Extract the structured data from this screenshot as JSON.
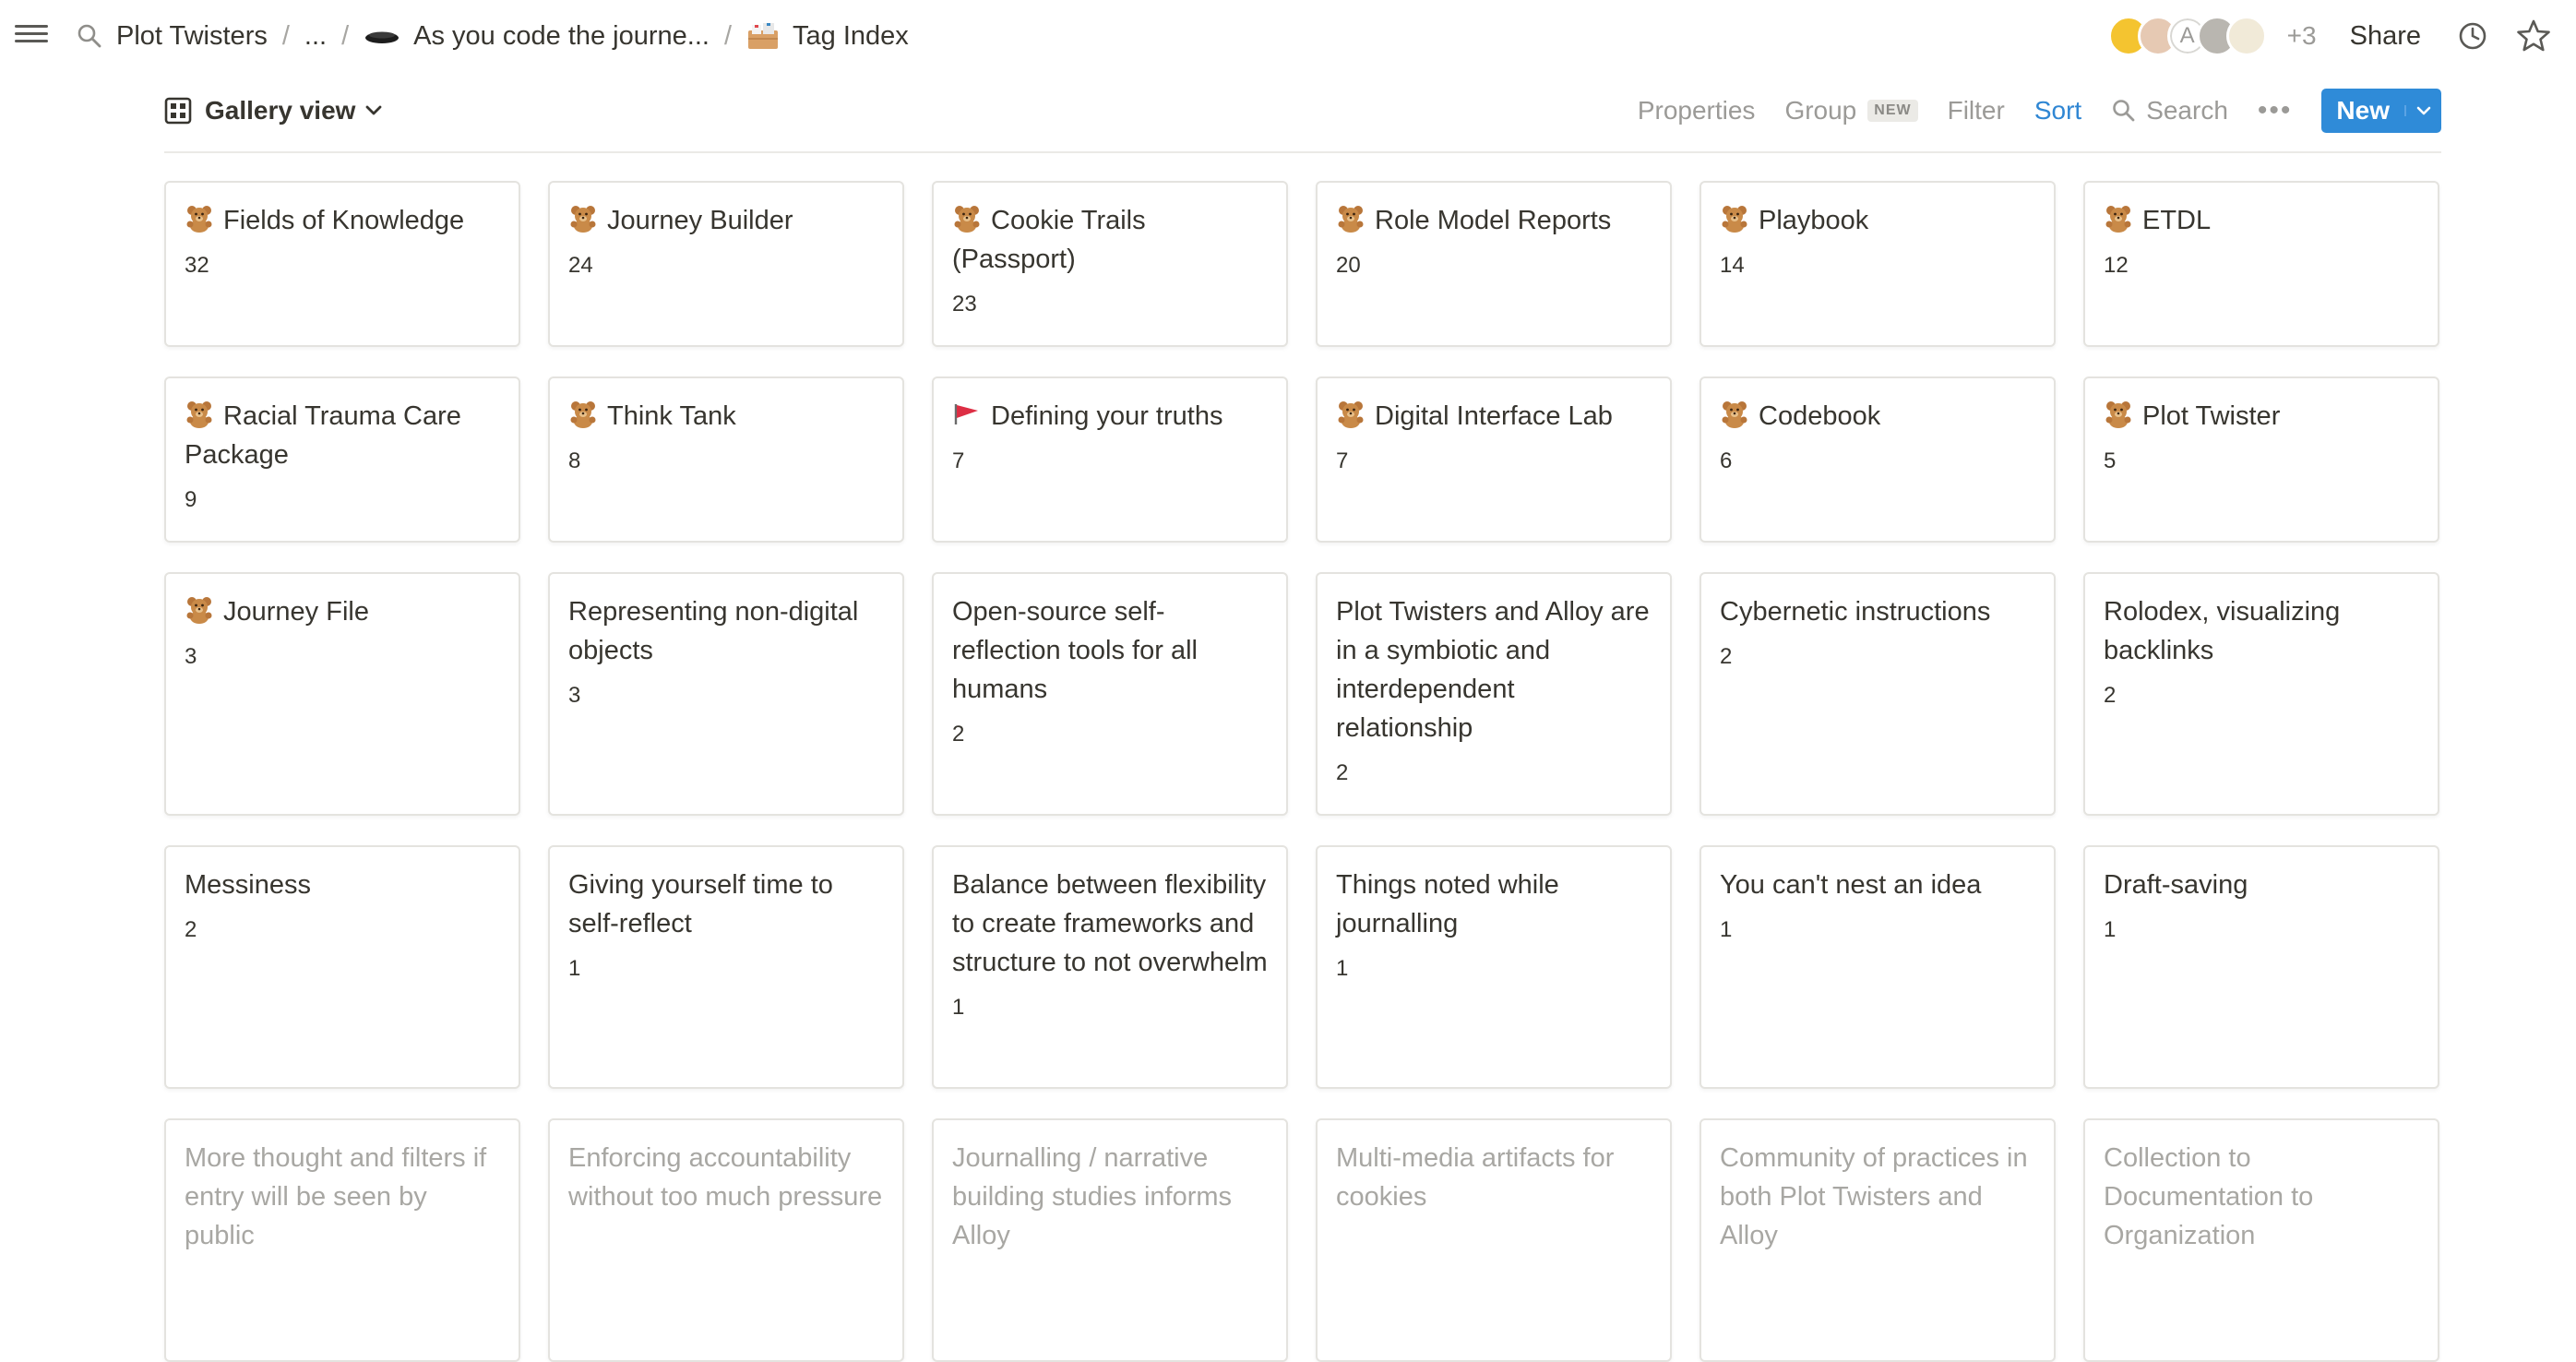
{
  "breadcrumb": {
    "items": [
      "Plot Twisters",
      "...",
      "As you code the journe...",
      "Tag Index"
    ],
    "separator": "/"
  },
  "collaborators": {
    "more_count": "+3",
    "avatar_letter": "A"
  },
  "header": {
    "share_label": "Share"
  },
  "view": {
    "name": "Gallery view",
    "properties_label": "Properties",
    "group_label": "Group",
    "group_badge": "NEW",
    "filter_label": "Filter",
    "sort_label": "Sort",
    "search_label": "Search",
    "new_label": "New",
    "sort_color": "#2f86d3",
    "accent_color": "#2f8bd8"
  },
  "cards": [
    {
      "title": "Fields of Knowledge",
      "count": "32",
      "icon": "teddy-bear-icon"
    },
    {
      "title": "Journey Builder",
      "count": "24",
      "icon": "teddy-bear-icon"
    },
    {
      "title": "Cookie Trails (Passport)",
      "count": "23",
      "icon": "teddy-bear-icon"
    },
    {
      "title": "Role Model Reports",
      "count": "20",
      "icon": "teddy-bear-icon"
    },
    {
      "title": "Playbook",
      "count": "14",
      "icon": "teddy-bear-icon"
    },
    {
      "title": "ETDL",
      "count": "12",
      "icon": "teddy-bear-icon"
    },
    {
      "title": "Racial Trauma Care Package",
      "count": "9",
      "icon": "teddy-bear-icon"
    },
    {
      "title": "Think Tank",
      "count": "8",
      "icon": "teddy-bear-icon"
    },
    {
      "title": "Defining your truths",
      "count": "7",
      "icon": "red-flag-icon"
    },
    {
      "title": "Digital Interface Lab",
      "count": "7",
      "icon": "teddy-bear-icon"
    },
    {
      "title": "Codebook",
      "count": "6",
      "icon": "teddy-bear-icon"
    },
    {
      "title": "Plot Twister",
      "count": "5",
      "icon": "teddy-bear-icon"
    },
    {
      "title": "Journey File",
      "count": "3",
      "icon": "teddy-bear-icon"
    },
    {
      "title": "Representing non-digital objects",
      "count": "3",
      "icon": ""
    },
    {
      "title": "Open-source self-reflection tools for all humans",
      "count": "2",
      "icon": ""
    },
    {
      "title": "Plot Twisters and Alloy are in a symbiotic and interdependent relationship",
      "count": "2",
      "icon": ""
    },
    {
      "title": "Cybernetic instructions",
      "count": "2",
      "icon": ""
    },
    {
      "title": "Rolodex, visualizing backlinks",
      "count": "2",
      "icon": ""
    },
    {
      "title": "Messiness",
      "count": "2",
      "icon": ""
    },
    {
      "title": "Giving yourself time to self-reflect",
      "count": "1",
      "icon": ""
    },
    {
      "title": "Balance between flexibility to create frameworks and structure to not overwhelm",
      "count": "1",
      "icon": ""
    },
    {
      "title": "Things noted while journalling",
      "count": "1",
      "icon": ""
    },
    {
      "title": "You can't nest an idea",
      "count": "1",
      "icon": ""
    },
    {
      "title": "Draft-saving",
      "count": "1",
      "icon": ""
    },
    {
      "title": "More thought and filters if entry will be seen by public",
      "count": "",
      "icon": ""
    },
    {
      "title": "Enforcing accountability without too much pressure",
      "count": "",
      "icon": ""
    },
    {
      "title": "Journalling / narrative building studies informs Alloy",
      "count": "",
      "icon": ""
    },
    {
      "title": "Multi-media artifacts for cookies",
      "count": "",
      "icon": ""
    },
    {
      "title": "Community of practices in both Plot Twisters and Alloy",
      "count": "",
      "icon": ""
    },
    {
      "title": "Collection to Documentation to Organization",
      "count": "",
      "icon": ""
    }
  ]
}
